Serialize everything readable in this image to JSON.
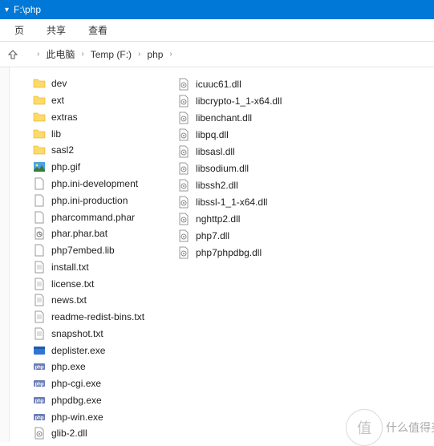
{
  "title": "F:\\php",
  "tabs": {
    "t1": "页",
    "t2": "共享",
    "t3": "查看"
  },
  "crumbs": {
    "c1": "此电脑",
    "c2": "Temp (F:)",
    "c3": "php"
  },
  "col1": [
    {
      "n": "dev",
      "t": "folder"
    },
    {
      "n": "ext",
      "t": "folder"
    },
    {
      "n": "extras",
      "t": "folder"
    },
    {
      "n": "lib",
      "t": "folder"
    },
    {
      "n": "sasl2",
      "t": "folder"
    },
    {
      "n": "php.gif",
      "t": "gif"
    },
    {
      "n": "php.ini-development",
      "t": "ini"
    },
    {
      "n": "php.ini-production",
      "t": "ini"
    },
    {
      "n": "pharcommand.phar",
      "t": "file"
    },
    {
      "n": "phar.phar.bat",
      "t": "bat"
    },
    {
      "n": "php7embed.lib",
      "t": "file"
    },
    {
      "n": "install.txt",
      "t": "txt"
    },
    {
      "n": "license.txt",
      "t": "txt"
    },
    {
      "n": "news.txt",
      "t": "txt"
    },
    {
      "n": "readme-redist-bins.txt",
      "t": "txt"
    },
    {
      "n": "snapshot.txt",
      "t": "txt"
    },
    {
      "n": "deplister.exe",
      "t": "exe"
    },
    {
      "n": "php.exe",
      "t": "php"
    },
    {
      "n": "php-cgi.exe",
      "t": "php"
    },
    {
      "n": "phpdbg.exe",
      "t": "php"
    },
    {
      "n": "php-win.exe",
      "t": "php"
    },
    {
      "n": "glib-2.dll",
      "t": "dll"
    }
  ],
  "col2": [
    {
      "n": "icuuc61.dll",
      "t": "dll"
    },
    {
      "n": "libcrypto-1_1-x64.dll",
      "t": "dll"
    },
    {
      "n": "libenchant.dll",
      "t": "dll"
    },
    {
      "n": "libpq.dll",
      "t": "dll"
    },
    {
      "n": "libsasl.dll",
      "t": "dll"
    },
    {
      "n": "libsodium.dll",
      "t": "dll"
    },
    {
      "n": "libssh2.dll",
      "t": "dll"
    },
    {
      "n": "libssl-1_1-x64.dll",
      "t": "dll"
    },
    {
      "n": "nghttp2.dll",
      "t": "dll"
    },
    {
      "n": "php7.dll",
      "t": "dll"
    },
    {
      "n": "php7phpdbg.dll",
      "t": "dll"
    }
  ],
  "watermark": "什么值得买"
}
